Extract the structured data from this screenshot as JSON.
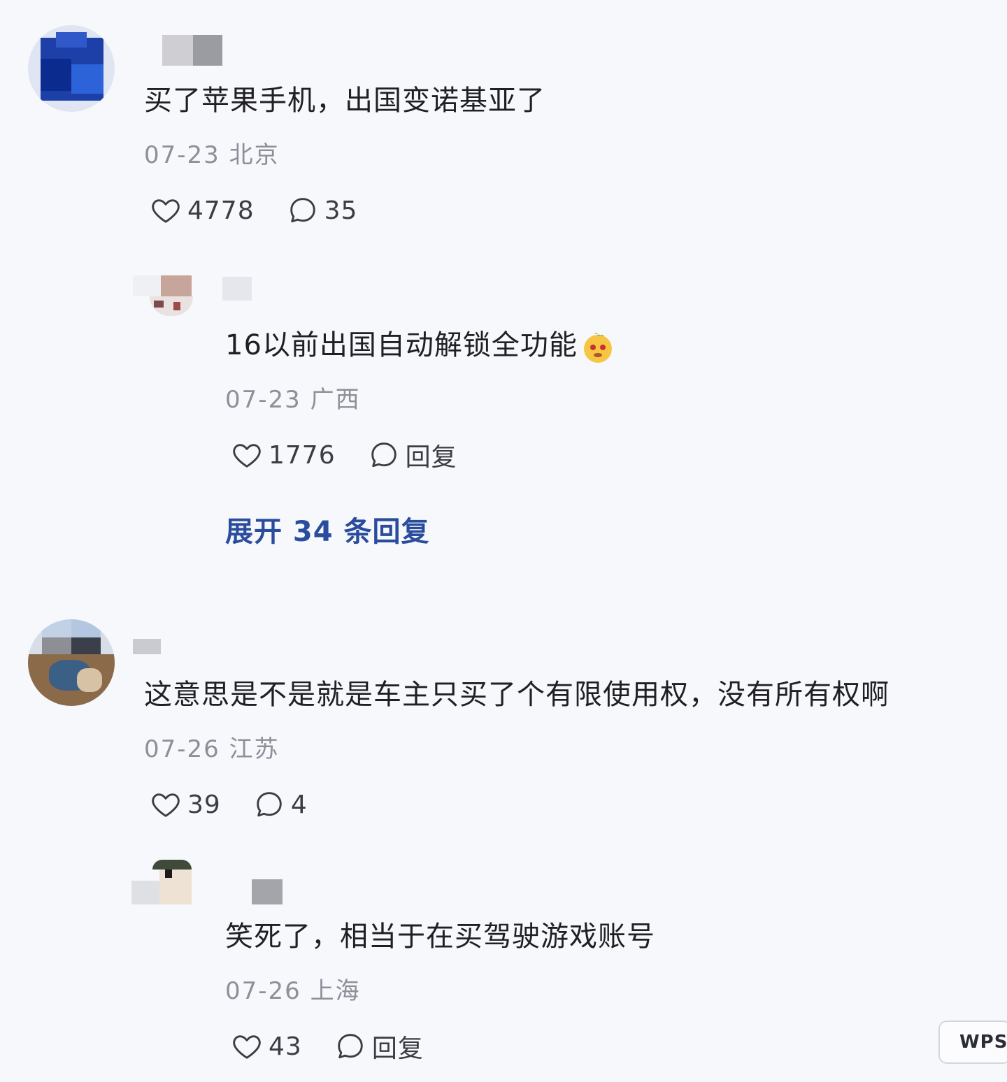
{
  "comments": [
    {
      "text": "买了苹果手机，出国变诺基亚了",
      "meta": "07-23 北京",
      "likes": "4778",
      "replies_count": "35",
      "reply": {
        "text": "16以前出国自动解锁全功能",
        "meta": "07-23 广西",
        "likes": "1776",
        "reply_label": "回复"
      },
      "expand_label": "展开 34 条回复"
    },
    {
      "text": "这意思是不是就是车主只买了个有限使用权，没有所有权啊",
      "meta": "07-26 江苏",
      "likes": "39",
      "replies_count": "4",
      "reply": {
        "text": "笑死了，相当于在买驾驶游戏账号",
        "meta": "07-26 上海",
        "likes": "43",
        "reply_label": "回复"
      }
    }
  ],
  "watermark": "WPS",
  "colors": {
    "background": "#f7f8fc",
    "text": "#1f1f24",
    "meta": "#8d8f99",
    "link": "#2a4c9c"
  }
}
